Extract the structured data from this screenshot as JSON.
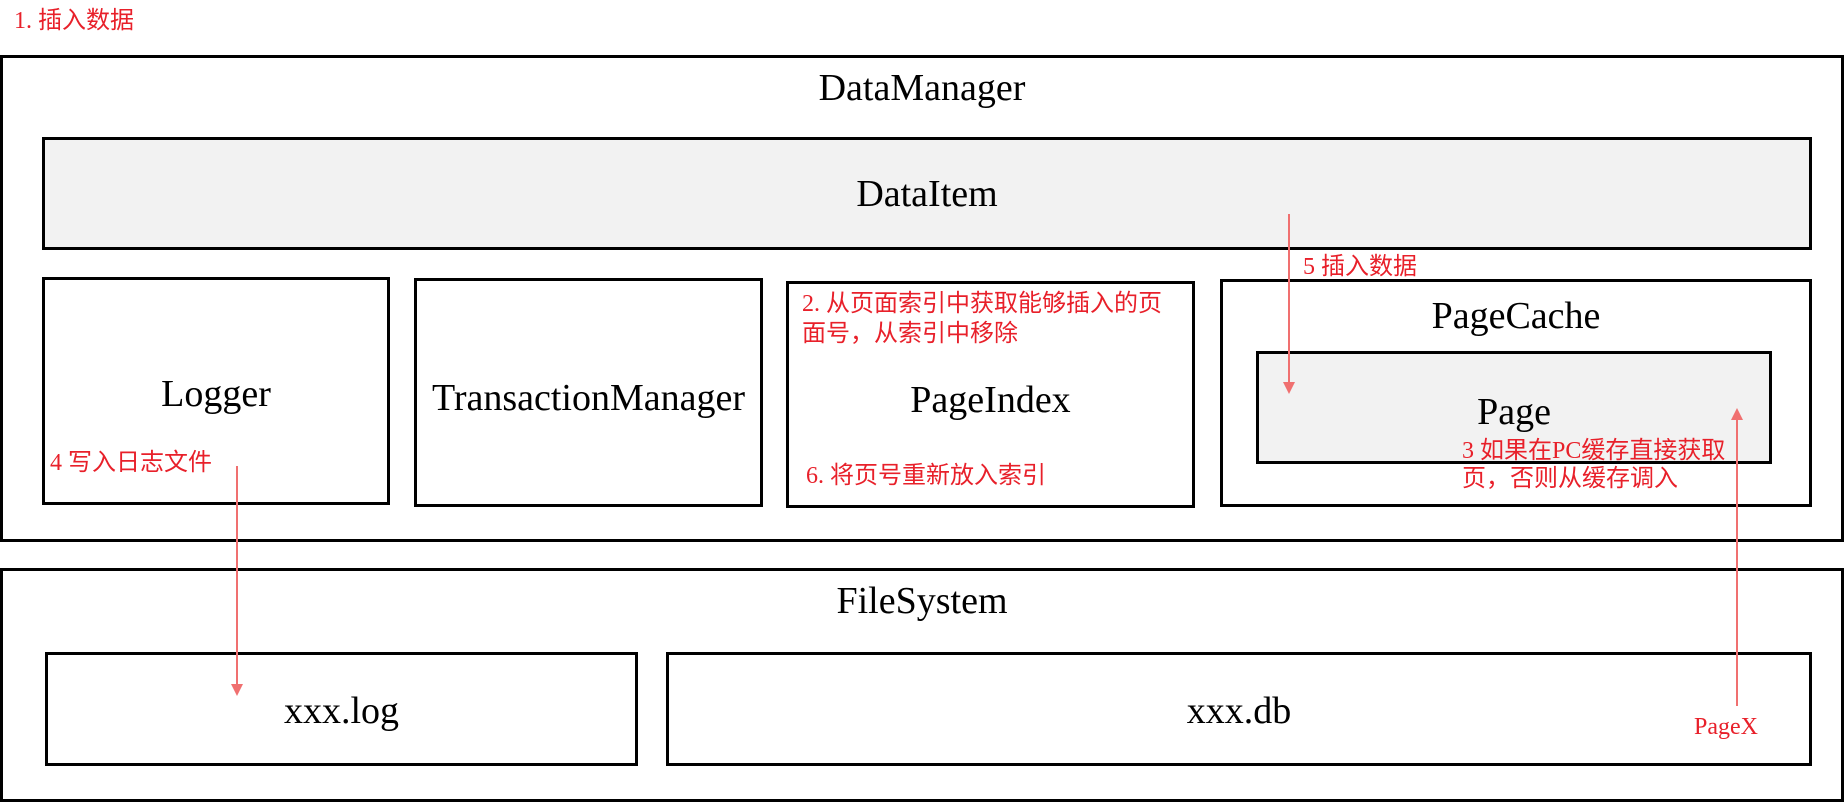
{
  "diagram": {
    "step_1_note": "1. 插入数据",
    "data_manager": {
      "title": "DataManager",
      "data_item": {
        "title": "DataItem"
      },
      "logger": {
        "title": "Logger",
        "note": "4 写入日志文件"
      },
      "transaction_manager": {
        "title": "TransactionManager"
      },
      "page_index": {
        "title": "PageIndex",
        "note_top_line1": "2. 从页面索引中获取能够插入的页",
        "note_top_line2": "面号，从索引中移除",
        "note_bottom": "6. 将页号重新放入索引"
      },
      "page_cache": {
        "title": "PageCache",
        "page": {
          "title": "Page"
        },
        "insert_note": "5 插入数据",
        "fetch_note_line1": "3 如果在PC缓存直接获取",
        "fetch_note_line2": "页，否则从缓存调入"
      }
    },
    "file_system": {
      "title": "FileSystem",
      "log_file": {
        "title": "xxx.log"
      },
      "db_file": {
        "title": "xxx.db",
        "page_label": "PageX"
      }
    },
    "colors": {
      "annotation": "#e8202a",
      "arrow": "#f07070",
      "border": "#000000",
      "grey_fill": "#f2f2f2"
    }
  }
}
